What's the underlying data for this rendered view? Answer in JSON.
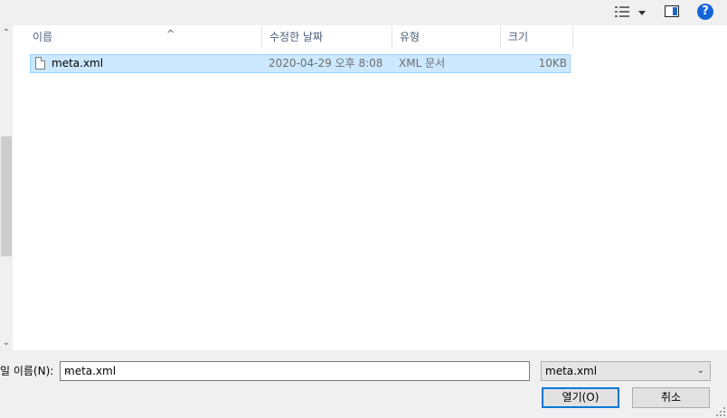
{
  "toolbar": {
    "view_icon": "details-view-icon",
    "view_dropdown_icon": "caret-down-icon",
    "preview_pane_icon": "preview-pane-icon",
    "help_label": "?"
  },
  "columns": {
    "name": "이름",
    "modified": "수정한 날짜",
    "type": "유형",
    "size": "크기"
  },
  "files": [
    {
      "name": "meta.xml",
      "modified": "2020-04-29 오후 8:08",
      "type": "XML 문서",
      "size": "10KB",
      "icon": "document-icon"
    }
  ],
  "bottom": {
    "filename_label": "일 이름(N):",
    "filename_value": "meta.xml",
    "filetype_value": "meta.xml",
    "open_label": "열기(O)",
    "cancel_label": "취소"
  },
  "colors": {
    "selection_bg": "#cce8ff",
    "selection_border": "#99d1ff",
    "accent": "#0078d7"
  }
}
